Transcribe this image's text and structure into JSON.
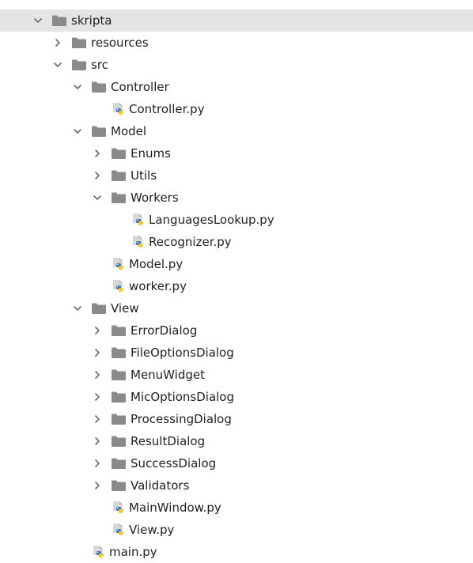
{
  "tree": [
    {
      "label": "skripta",
      "type": "folder",
      "depth": 0,
      "expanded": true,
      "selected": true,
      "icon": "folder-icon"
    },
    {
      "label": "resources",
      "type": "folder",
      "depth": 1,
      "expanded": false,
      "icon": "folder-icon"
    },
    {
      "label": "src",
      "type": "folder",
      "depth": 1,
      "expanded": true,
      "icon": "folder-icon"
    },
    {
      "label": "Controller",
      "type": "folder",
      "depth": 2,
      "expanded": true,
      "icon": "folder-icon"
    },
    {
      "label": "Controller.py",
      "type": "file",
      "depth": 3,
      "icon": "python-file-icon"
    },
    {
      "label": "Model",
      "type": "folder",
      "depth": 2,
      "expanded": true,
      "icon": "folder-icon"
    },
    {
      "label": "Enums",
      "type": "folder",
      "depth": 3,
      "expanded": false,
      "icon": "folder-icon"
    },
    {
      "label": "Utils",
      "type": "folder",
      "depth": 3,
      "expanded": false,
      "icon": "folder-icon"
    },
    {
      "label": "Workers",
      "type": "folder",
      "depth": 3,
      "expanded": true,
      "icon": "folder-icon"
    },
    {
      "label": "LanguagesLookup.py",
      "type": "file",
      "depth": 4,
      "icon": "python-file-icon"
    },
    {
      "label": "Recognizer.py",
      "type": "file",
      "depth": 4,
      "icon": "python-file-icon"
    },
    {
      "label": "Model.py",
      "type": "file",
      "depth": 3,
      "icon": "python-file-icon"
    },
    {
      "label": "worker.py",
      "type": "file",
      "depth": 3,
      "icon": "python-file-icon"
    },
    {
      "label": "View",
      "type": "folder",
      "depth": 2,
      "expanded": true,
      "icon": "folder-icon"
    },
    {
      "label": "ErrorDialog",
      "type": "folder",
      "depth": 3,
      "expanded": false,
      "icon": "folder-icon"
    },
    {
      "label": "FileOptionsDialog",
      "type": "folder",
      "depth": 3,
      "expanded": false,
      "icon": "folder-icon"
    },
    {
      "label": "MenuWidget",
      "type": "folder",
      "depth": 3,
      "expanded": false,
      "icon": "folder-icon"
    },
    {
      "label": "MicOptionsDialog",
      "type": "folder",
      "depth": 3,
      "expanded": false,
      "icon": "folder-icon"
    },
    {
      "label": "ProcessingDialog",
      "type": "folder",
      "depth": 3,
      "expanded": false,
      "icon": "folder-icon"
    },
    {
      "label": "ResultDialog",
      "type": "folder",
      "depth": 3,
      "expanded": false,
      "icon": "folder-icon"
    },
    {
      "label": "SuccessDialog",
      "type": "folder",
      "depth": 3,
      "expanded": false,
      "icon": "folder-icon"
    },
    {
      "label": "Validators",
      "type": "folder",
      "depth": 3,
      "expanded": false,
      "icon": "folder-icon"
    },
    {
      "label": "MainWindow.py",
      "type": "file",
      "depth": 3,
      "icon": "python-file-icon"
    },
    {
      "label": "View.py",
      "type": "file",
      "depth": 3,
      "icon": "python-file-icon"
    },
    {
      "label": "main.py",
      "type": "file",
      "depth": 2,
      "icon": "python-file-icon"
    }
  ],
  "colors": {
    "folder": "#8a8a8a",
    "chevron": "#6b6b6b",
    "selected_row": "#e4e4e4",
    "python_blue": "#3b78b8",
    "python_yellow": "#f2c62f"
  }
}
